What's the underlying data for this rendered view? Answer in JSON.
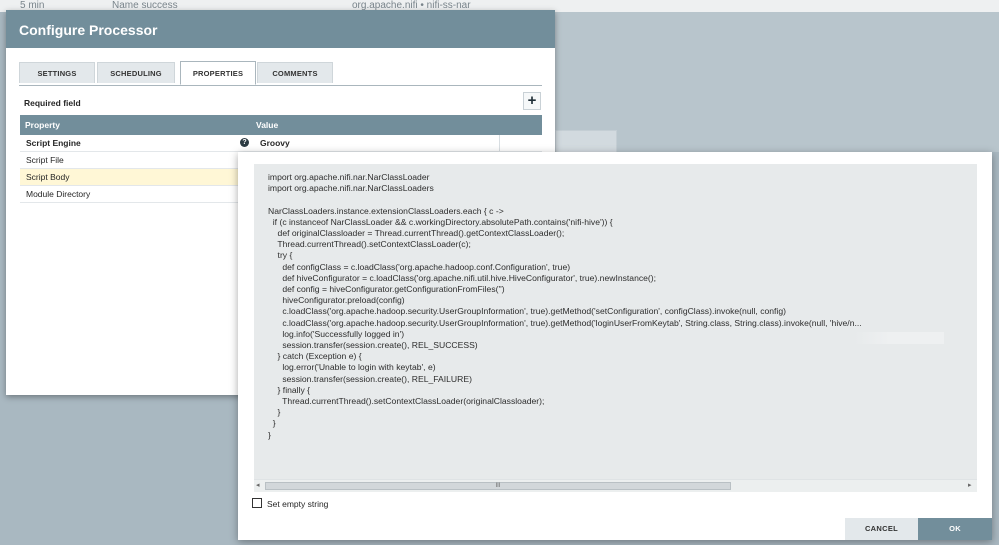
{
  "background": {
    "top_left_label": "5 min",
    "top_name_label": "Name  success",
    "top_right_label": "org.apache.nifi • nifi-ss-nar"
  },
  "dialog": {
    "title": "Configure Processor",
    "tabs": [
      {
        "label": "SETTINGS"
      },
      {
        "label": "SCHEDULING"
      },
      {
        "label": "PROPERTIES"
      },
      {
        "label": "COMMENTS"
      }
    ],
    "required_label": "Required field",
    "add_symbol": "+",
    "table": {
      "headers": {
        "property": "Property",
        "value": "Value"
      },
      "rows": [
        {
          "name": "Script Engine",
          "value": "Groovy"
        },
        {
          "name": "Script File",
          "value": ""
        },
        {
          "name": "Script Body",
          "value": ""
        },
        {
          "name": "Module Directory",
          "value": ""
        }
      ]
    }
  },
  "editor": {
    "code": "import org.apache.nifi.nar.NarClassLoader\nimport org.apache.nifi.nar.NarClassLoaders\n\nNarClassLoaders.instance.extensionClassLoaders.each { c ->\n  if (c instanceof NarClassLoader && c.workingDirectory.absolutePath.contains('nifi-hive')) {\n    def originalClassloader = Thread.currentThread().getContextClassLoader();\n    Thread.currentThread().setContextClassLoader(c);\n    try {\n      def configClass = c.loadClass('org.apache.hadoop.conf.Configuration', true)\n      def hiveConfigurator = c.loadClass('org.apache.nifi.util.hive.HiveConfigurator', true).newInstance();\n      def config = hiveConfigurator.getConfigurationFromFiles('')\n      hiveConfigurator.preload(config)\n      c.loadClass('org.apache.hadoop.security.UserGroupInformation', true).getMethod('setConfiguration', configClass).invoke(null, config)\n      c.loadClass('org.apache.hadoop.security.UserGroupInformation', true).getMethod('loginUserFromKeytab', String.class, String.class).invoke(null, 'hive/n...\n      log.info('Successfully logged in')\n      session.transfer(session.create(), REL_SUCCESS)\n    } catch (Exception e) {\n      log.error('Unable to login with keytab', e)\n      session.transfer(session.create(), REL_FAILURE)\n    } finally {\n      Thread.currentThread().setContextClassLoader(originalClassloader);\n    }\n  }\n}",
    "scroll_left": "◂",
    "scroll_right": "▸",
    "scroll_grip": "III",
    "set_empty_label": "Set empty string",
    "cancel_label": "CANCEL",
    "ok_label": "OK"
  }
}
